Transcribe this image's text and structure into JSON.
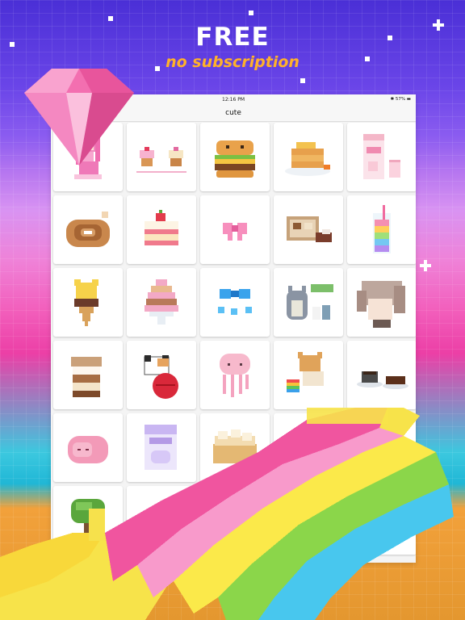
{
  "promo": {
    "headline": "FREE",
    "subheadline": "no subscription"
  },
  "device": {
    "status_time": "12:16 PM",
    "status_right": "✱ 57% ▬",
    "nav_title": "cute"
  },
  "gallery": {
    "tiles": [
      {
        "icon": "pink-mermaid-girl-icon"
      },
      {
        "icon": "cupcakes-icon"
      },
      {
        "icon": "smiling-burger-icon"
      },
      {
        "icon": "pancakes-icon"
      },
      {
        "icon": "milk-carton-icon"
      },
      {
        "icon": "cinnamon-roll-icon"
      },
      {
        "icon": "strawberry-cake-slice-icon"
      },
      {
        "icon": "pink-bow-icon"
      },
      {
        "icon": "cookie-box-icon"
      },
      {
        "icon": "rainbow-drink-icon"
      },
      {
        "icon": "bear-ice-cream-icon"
      },
      {
        "icon": "macaron-tower-icon"
      },
      {
        "icon": "blue-bow-hearts-icon"
      },
      {
        "icon": "totoro-icon"
      },
      {
        "icon": "anime-character-icon"
      },
      {
        "icon": "jar-dessert-icon"
      },
      {
        "icon": "cat-yarn-icon"
      },
      {
        "icon": "jellyfish-icon"
      },
      {
        "icon": "dog-rainbow-icon"
      },
      {
        "icon": "coffee-brownies-icon"
      },
      {
        "icon": "pink-sleeping-animal-icon"
      },
      {
        "icon": "milk-box-icon"
      },
      {
        "icon": "dumplings-icon"
      },
      {
        "icon": "hidden-tile-icon"
      },
      {
        "icon": "hidden-tile-icon"
      },
      {
        "icon": "green-tree-icon"
      },
      {
        "icon": "hidden-tile-icon"
      },
      {
        "icon": "hidden-tile-icon"
      },
      {
        "icon": "hidden-tile-icon"
      },
      {
        "icon": "hidden-tile-icon"
      }
    ]
  },
  "decor": {
    "gem_color": "#f36fb0",
    "rainbow_colors": [
      "#f0559f",
      "#f89acb",
      "#fbe94a",
      "#8bd64a",
      "#48c7ee"
    ]
  }
}
